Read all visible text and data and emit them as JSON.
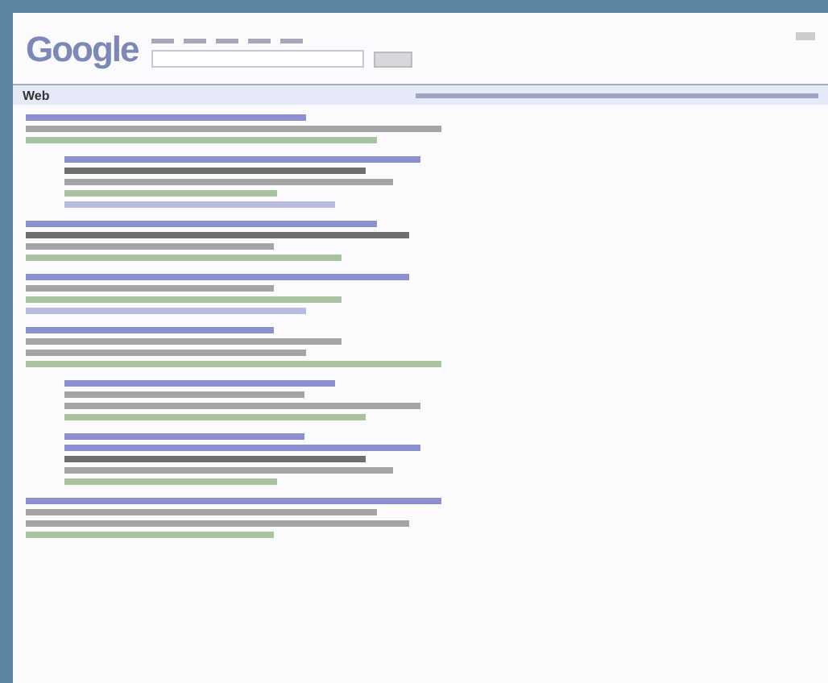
{
  "header": {
    "logo": "Google"
  },
  "results_bar": {
    "label": "Web"
  },
  "results": [
    {
      "indented": false,
      "lines": [
        {
          "kind": "title"
        },
        {
          "kind": "snippet"
        },
        {
          "kind": "url"
        }
      ]
    },
    {
      "indented": true,
      "lines": [
        {
          "kind": "title"
        },
        {
          "kind": "strong"
        },
        {
          "kind": "snippet"
        },
        {
          "kind": "url"
        },
        {
          "kind": "links"
        }
      ]
    },
    {
      "indented": false,
      "lines": [
        {
          "kind": "title"
        },
        {
          "kind": "strong"
        },
        {
          "kind": "snippet"
        },
        {
          "kind": "url"
        }
      ]
    },
    {
      "indented": false,
      "lines": [
        {
          "kind": "title"
        },
        {
          "kind": "snippet"
        },
        {
          "kind": "url"
        },
        {
          "kind": "links"
        }
      ]
    },
    {
      "indented": false,
      "lines": [
        {
          "kind": "title"
        },
        {
          "kind": "snippet"
        },
        {
          "kind": "snippet"
        },
        {
          "kind": "url"
        }
      ]
    },
    {
      "indented": true,
      "lines": [
        {
          "kind": "title"
        },
        {
          "kind": "snippet"
        },
        {
          "kind": "snippet"
        },
        {
          "kind": "url"
        }
      ]
    },
    {
      "indented": true,
      "lines": [
        {
          "kind": "title"
        },
        {
          "kind": "title"
        },
        {
          "kind": "strong"
        },
        {
          "kind": "snippet"
        },
        {
          "kind": "url"
        }
      ]
    },
    {
      "indented": false,
      "lines": [
        {
          "kind": "title"
        },
        {
          "kind": "snippet"
        },
        {
          "kind": "snippet"
        },
        {
          "kind": "url"
        }
      ]
    }
  ]
}
